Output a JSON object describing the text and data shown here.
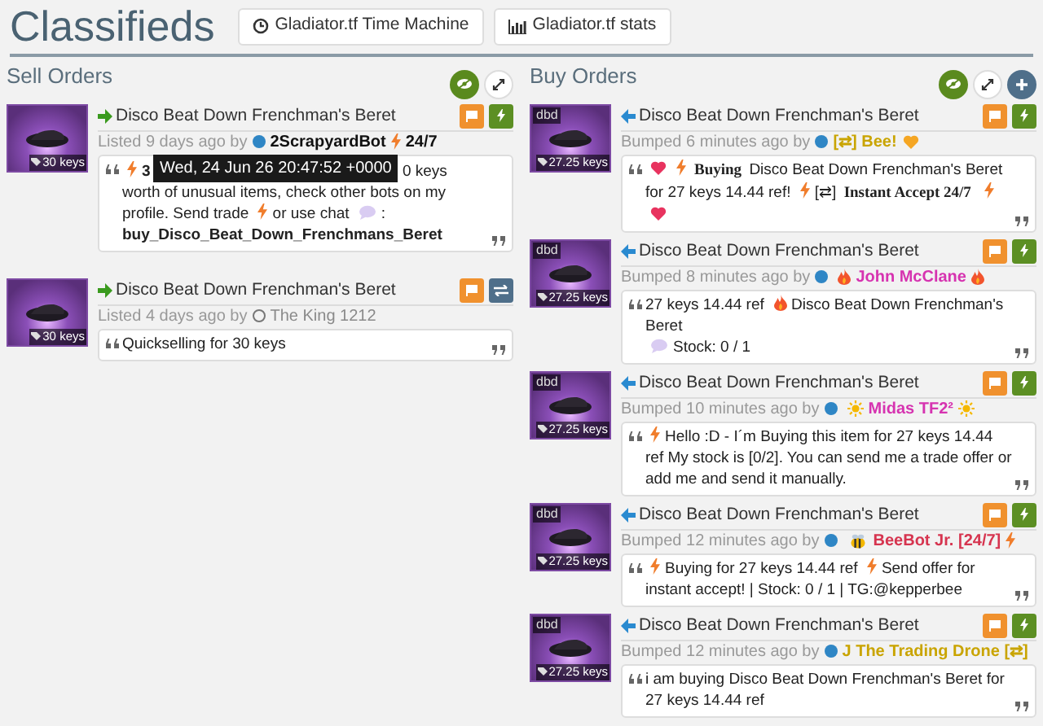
{
  "header": {
    "title": "Classifieds",
    "buttons": [
      {
        "kind": "clock",
        "label": "Gladiator.tf Time Machine"
      },
      {
        "kind": "chart",
        "label": "Gladiator.tf stats"
      }
    ]
  },
  "columns": [
    {
      "title": "Sell Orders",
      "tools": [
        {
          "kind": "eye"
        },
        {
          "kind": "expand"
        }
      ],
      "listings": [
        {
          "kind": "sell",
          "price": "30 keys",
          "title": "Disco Beat Down Frenchman's Beret",
          "meta": "Listed 9 days ago by",
          "user": {
            "online": true,
            "color": "#111111",
            "bold": true,
            "parts": [
              {
                "kind": "text",
                "text": "2ScrapyardBot"
              },
              {
                "kind": "bolt"
              },
              {
                "kind": "text",
                "text": "24/7"
              }
            ]
          },
          "actions": [
            {
              "kind": "flag"
            },
            {
              "kind": "bolt"
            }
          ],
          "tooltip": "Wed, 24 Jun 26 20:47:52 +0000",
          "message": [
            {
              "kind": "bolt"
            },
            {
              "kind": "bold",
              "text": "3"
            },
            {
              "kind": "gap"
            },
            {
              "kind": "text",
              "text": "0 keys worth of unusual items, check other bots on my profile. Send trade"
            },
            {
              "kind": "bolt"
            },
            {
              "kind": "text",
              "text": "or use chat"
            },
            {
              "kind": "chat"
            },
            {
              "kind": "text",
              "text": ":"
            },
            {
              "kind": "break"
            },
            {
              "kind": "bold",
              "text": "buy_Disco_Beat_Down_Frenchmans_Beret"
            }
          ]
        },
        {
          "kind": "sell",
          "price": "30 keys",
          "title": "Disco Beat Down Frenchman's Beret",
          "meta": "Listed 4 days ago by",
          "user": {
            "online": false,
            "color": "#8a8a8a",
            "bold": false,
            "parts": [
              {
                "kind": "text",
                "text": "The King 1212"
              }
            ]
          },
          "actions": [
            {
              "kind": "flag"
            },
            {
              "kind": "swap"
            }
          ],
          "message": [
            {
              "kind": "text",
              "text": "Quickselling for 30 keys"
            }
          ]
        }
      ]
    },
    {
      "title": "Buy Orders",
      "tools": [
        {
          "kind": "eye"
        },
        {
          "kind": "expand"
        },
        {
          "kind": "plus"
        }
      ],
      "listings": [
        {
          "kind": "buy",
          "price": "27.25 keys",
          "tag": "dbd",
          "title": "Disco Beat Down Frenchman's Beret",
          "meta": "Bumped 6 minutes ago by",
          "user": {
            "online": true,
            "color": "#c9a400",
            "bold": true,
            "parts": [
              {
                "kind": "text",
                "text": "[⇄] Bee!"
              },
              {
                "kind": "heart-orange"
              }
            ]
          },
          "actions": [
            {
              "kind": "flag"
            },
            {
              "kind": "bolt"
            }
          ],
          "message": [
            {
              "kind": "heart"
            },
            {
              "kind": "bolt"
            },
            {
              "kind": "serif",
              "text": "Buying"
            },
            {
              "kind": "text",
              "text": "Disco Beat Down Frenchman's Beret for 27 keys 14.44 ref!"
            },
            {
              "kind": "bolt"
            },
            {
              "kind": "text",
              "text": "[⇄]"
            },
            {
              "kind": "serif",
              "text": "Instant Accept 24/7"
            },
            {
              "kind": "bolt"
            },
            {
              "kind": "heart"
            }
          ]
        },
        {
          "kind": "buy",
          "price": "27.25 keys",
          "tag": "dbd",
          "title": "Disco Beat Down Frenchman's Beret",
          "meta": "Bumped 8 minutes ago by",
          "user": {
            "online": true,
            "color": "#d633b0",
            "bold": true,
            "parts": [
              {
                "kind": "fire"
              },
              {
                "kind": "text",
                "text": "John McClane"
              },
              {
                "kind": "fire"
              }
            ]
          },
          "actions": [
            {
              "kind": "flag"
            },
            {
              "kind": "bolt"
            }
          ],
          "message": [
            {
              "kind": "text",
              "text": "27 keys 14.44 ref"
            },
            {
              "kind": "fire"
            },
            {
              "kind": "text",
              "text": "Disco Beat Down Frenchman's Beret"
            },
            {
              "kind": "break"
            },
            {
              "kind": "chat"
            },
            {
              "kind": "text",
              "text": "Stock: 0 / 1"
            }
          ]
        },
        {
          "kind": "buy",
          "price": "27.25 keys",
          "tag": "dbd",
          "title": "Disco Beat Down Frenchman's Beret",
          "meta": "Bumped 10 minutes ago by",
          "user": {
            "online": true,
            "color": "#d633b0",
            "bold": true,
            "parts": [
              {
                "kind": "sun"
              },
              {
                "kind": "text",
                "text": "Midas TF2²"
              },
              {
                "kind": "sun"
              }
            ]
          },
          "actions": [
            {
              "kind": "flag"
            },
            {
              "kind": "bolt"
            }
          ],
          "message": [
            {
              "kind": "bolt"
            },
            {
              "kind": "text",
              "text": "Hello :D - I´m Buying this item for 27 keys 14.44 ref My stock is [0/2]. You can send me a trade offer or add me and send it manually."
            }
          ]
        },
        {
          "kind": "buy",
          "price": "27.25 keys",
          "tag": "dbd",
          "title": "Disco Beat Down Frenchman's Beret",
          "meta": "Bumped 12 minutes ago by",
          "user": {
            "online": true,
            "color": "#d6344f",
            "bold": true,
            "parts": [
              {
                "kind": "bee"
              },
              {
                "kind": "text",
                "text": "BeeBot Jr. [24/7]"
              },
              {
                "kind": "bolt"
              }
            ]
          },
          "actions": [
            {
              "kind": "flag"
            },
            {
              "kind": "bolt"
            }
          ],
          "message": [
            {
              "kind": "bolt"
            },
            {
              "kind": "text",
              "text": "Buying for 27 keys 14.44 ref"
            },
            {
              "kind": "bolt"
            },
            {
              "kind": "text",
              "text": "Send offer for instant accept! | Stock: 0 / 1 | TG:@kepperbee"
            }
          ]
        },
        {
          "kind": "buy",
          "price": "27.25 keys",
          "tag": "dbd",
          "title": "Disco Beat Down Frenchman's Beret",
          "meta": "Bumped 12 minutes ago by",
          "user": {
            "online": true,
            "color": "#c9a400",
            "bold": true,
            "parts": [
              {
                "kind": "text",
                "text": "J The Trading Drone [⇄]"
              }
            ]
          },
          "actions": [
            {
              "kind": "flag"
            },
            {
              "kind": "bolt"
            }
          ],
          "message": [
            {
              "kind": "text",
              "text": "i am buying Disco Beat Down Frenchman's Beret for 27 keys 14.44 ref"
            }
          ]
        }
      ]
    }
  ]
}
